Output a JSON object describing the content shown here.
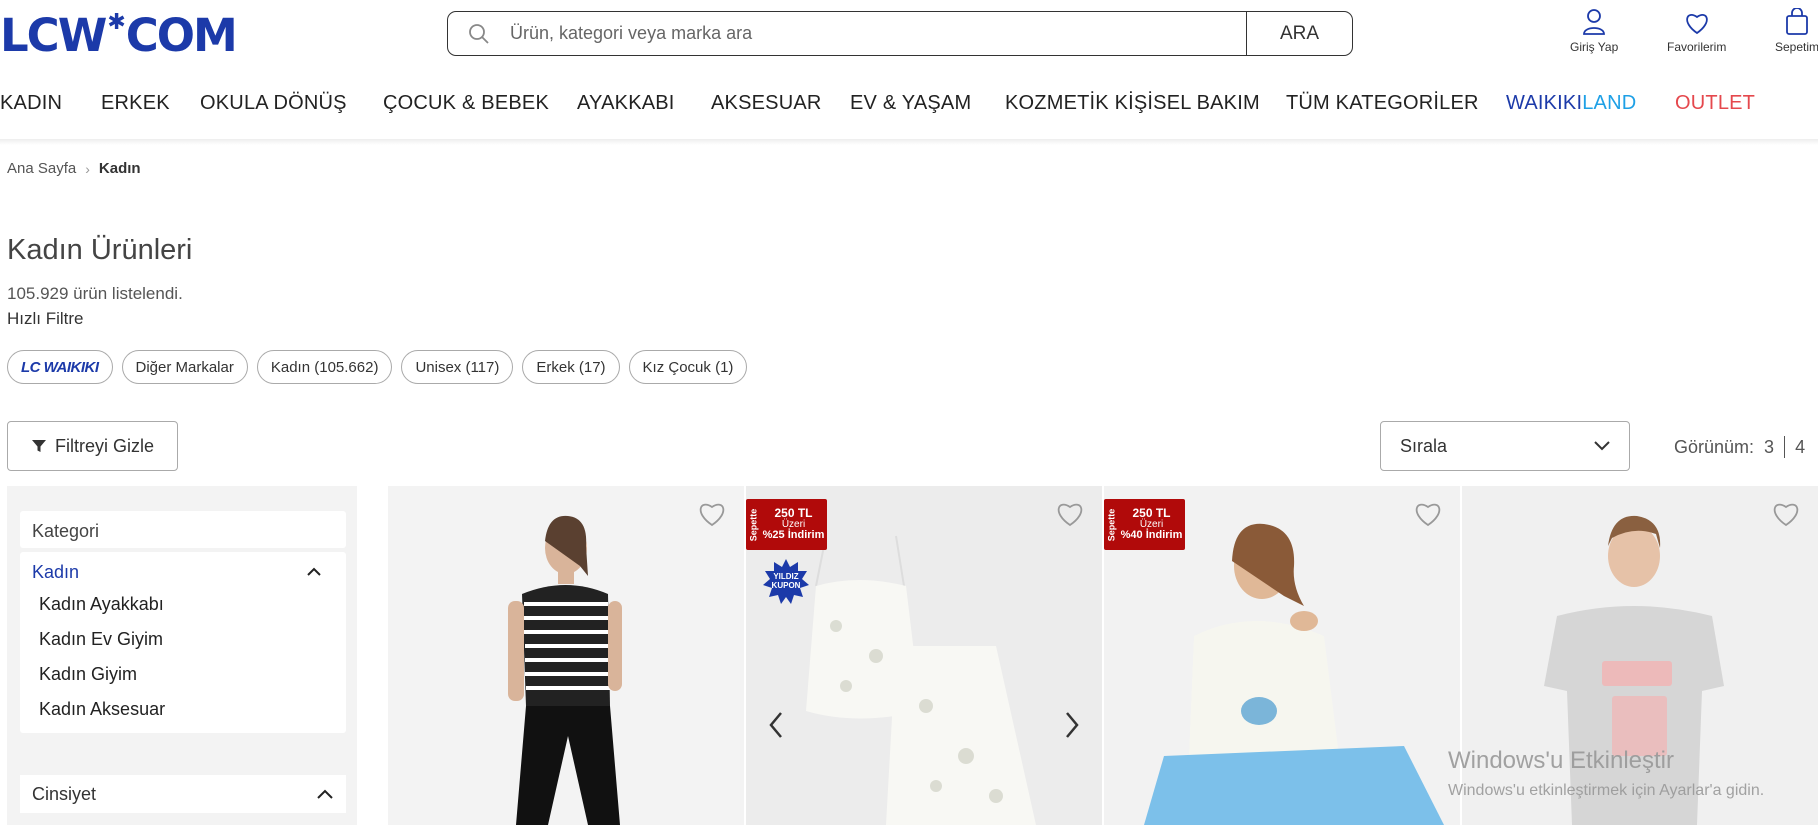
{
  "header": {
    "logo": "LCW·COM",
    "search_placeholder": "Ürün, kategori veya marka ara",
    "search_button": "ARA",
    "login_label": "Giriş Yap",
    "favorites_label": "Favorilerim",
    "cart_label": "Sepetim"
  },
  "nav": {
    "items": [
      "KADIN",
      "ERKEK",
      "OKULA DÖNÜŞ",
      "ÇOCUK & BEBEK",
      "AYAKKABI",
      "AKSESUAR",
      "EV & YAŞAM",
      "KOZMETİK KİŞİSEL BAKIM",
      "TÜM KATEGORİLER"
    ],
    "waikiki_part1": "WAIKIKI",
    "waikiki_part2": "LAND",
    "outlet": "OUTLET"
  },
  "breadcrumb": {
    "home": "Ana Sayfa",
    "current": "Kadın"
  },
  "page": {
    "title": "Kadın Ürünleri",
    "count": "105.929 ürün listelendi.",
    "quick_filter": "Hızlı Filtre"
  },
  "chips": {
    "brand": "LC WAIKIKI",
    "other_brands": "Diğer Markalar",
    "women": "Kadın (105.662)",
    "unisex": "Unisex (117)",
    "men": "Erkek (17)",
    "girl": "Kız Çocuk (1)"
  },
  "toolbar": {
    "filter_toggle": "Filtreyi Gizle",
    "sort_label": "Sırala",
    "view_label": "Görünüm:",
    "view_3": "3",
    "view_4": "4"
  },
  "sidebar": {
    "category_title": "Kategori",
    "active": "Kadın",
    "sub": [
      "Kadın Ayakkabı",
      "Kadın Ev Giyim",
      "Kadın Giyim",
      "Kadın Aksesuar"
    ],
    "gender_title": "Cinsiyet"
  },
  "products": {
    "badge_side": "Sepette",
    "badge_line1": "250 TL",
    "badge_line2": "Üzeri",
    "badge_p2": "%25 İndirim",
    "badge_p3": "%40 İndirim",
    "coupon_line1": "YILDIZ",
    "coupon_line2": "KUPON"
  },
  "watermark": {
    "line1": "Windows'u Etkinleştir",
    "line2": "Windows'u etkinleştirmek için Ayarlar'a gidin."
  },
  "colors": {
    "brand_blue": "#1c3aa9",
    "outlet_red": "#e5484d",
    "land_blue": "#1ea0e6",
    "badge_red": "#b10a0a"
  }
}
